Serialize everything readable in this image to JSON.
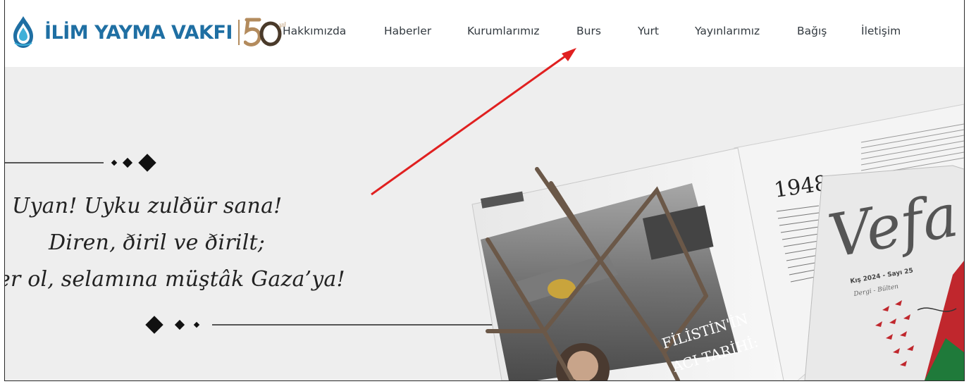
{
  "brand": {
    "name": "İLİM YAYMA VAKFI",
    "anniversary": "50",
    "colors": {
      "primary": "#1f6fa3",
      "accent": "#b38b5d"
    }
  },
  "nav": {
    "items": [
      {
        "label": "Hakkımızda"
      },
      {
        "label": "Haberler"
      },
      {
        "label": "Kurumlarımız"
      },
      {
        "label": "Burs"
      },
      {
        "label": "Yurt"
      },
      {
        "label": "Yayınlarımız"
      },
      {
        "label": "Bağış"
      },
      {
        "label": "İletişim"
      }
    ]
  },
  "hero": {
    "poem": {
      "line1": "Uyan! Uyku zulðür sana!",
      "line2": "Diren, ðiril ve ðirilt;",
      "line3": "er ol, selamına müştâk Gaza’ya!"
    },
    "magazine": {
      "title": "Vefa",
      "issue": "Kış 2024 - Sayı 25",
      "subtitle": "Dergi - Bülten",
      "article_year": "1948",
      "article_title_1": "FİLİSTİN'İN",
      "article_title_2": "ACI TARİHİ:"
    }
  },
  "annotation": {
    "arrow_color": "#e02020",
    "target": "Burs"
  }
}
